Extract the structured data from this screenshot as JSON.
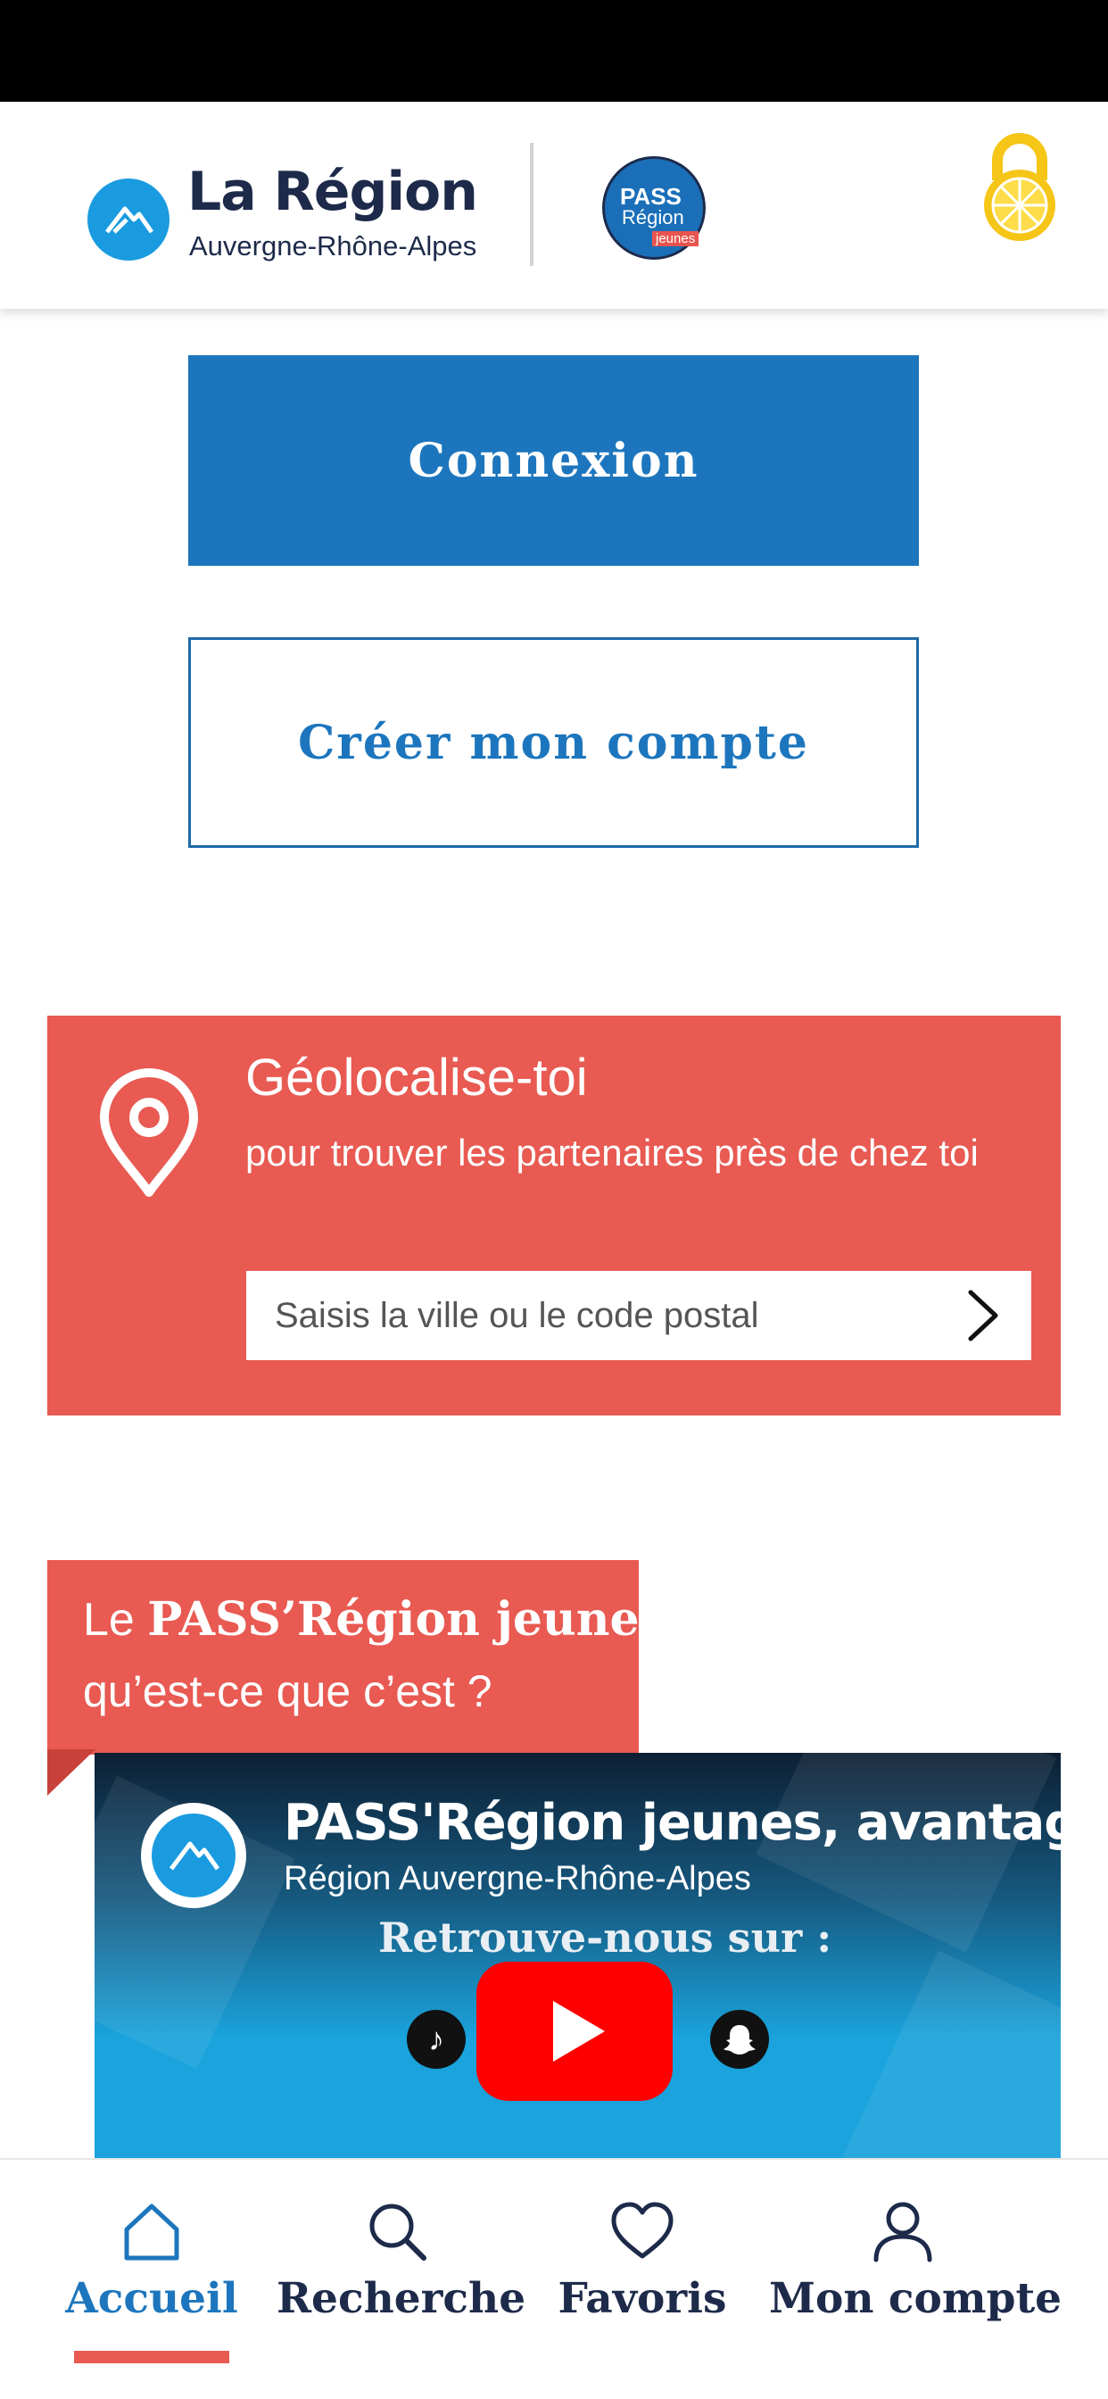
{
  "header": {
    "brand_title": "La Région",
    "brand_subtitle": "Auvergne-Rhône-Alpes",
    "pass_logo_line1": "PASS",
    "pass_logo_line2": "Région",
    "pass_logo_line3": "jeunes",
    "lock_icon": "lock-icon",
    "colors": {
      "brand_blue": "#1a9be0",
      "navy": "#1d2a4a",
      "lock_yellow": "#f5c518"
    }
  },
  "auth": {
    "login_label": "Connexion",
    "create_account_label": "Créer mon compte",
    "colors": {
      "primary": "#1d76bd"
    }
  },
  "geolocation": {
    "title": "Géolocalise-toi",
    "subtitle": "pour trouver les partenaires près de chez toi",
    "placeholder": "Saisis la ville ou le code postal",
    "pin_icon": "map-pin-icon",
    "submit_icon": "chevron-right-icon",
    "colors": {
      "card": "#e85a52"
    }
  },
  "pass_intro": {
    "prefix": "Le",
    "brand": "PASS’Région jeunes",
    "question": "qu’est-ce que c’est ?"
  },
  "video": {
    "title": "PASS'Région jeunes, avantages",
    "channel": "Région Auvergne-Rhône-Alpes",
    "tagline": "Retrouve-nous sur :",
    "play_icon": "youtube-play-icon",
    "colors": {
      "play": "#ff0000"
    }
  },
  "bottom_nav": {
    "items": [
      {
        "label": "Accueil",
        "icon": "home-icon",
        "active": true
      },
      {
        "label": "Recherche",
        "icon": "search-icon",
        "active": false
      },
      {
        "label": "Favoris",
        "icon": "heart-icon",
        "active": false
      },
      {
        "label": "Mon compte",
        "icon": "user-icon",
        "active": false
      }
    ],
    "colors": {
      "active": "#1d76bd",
      "indicator": "#e85a52"
    }
  }
}
